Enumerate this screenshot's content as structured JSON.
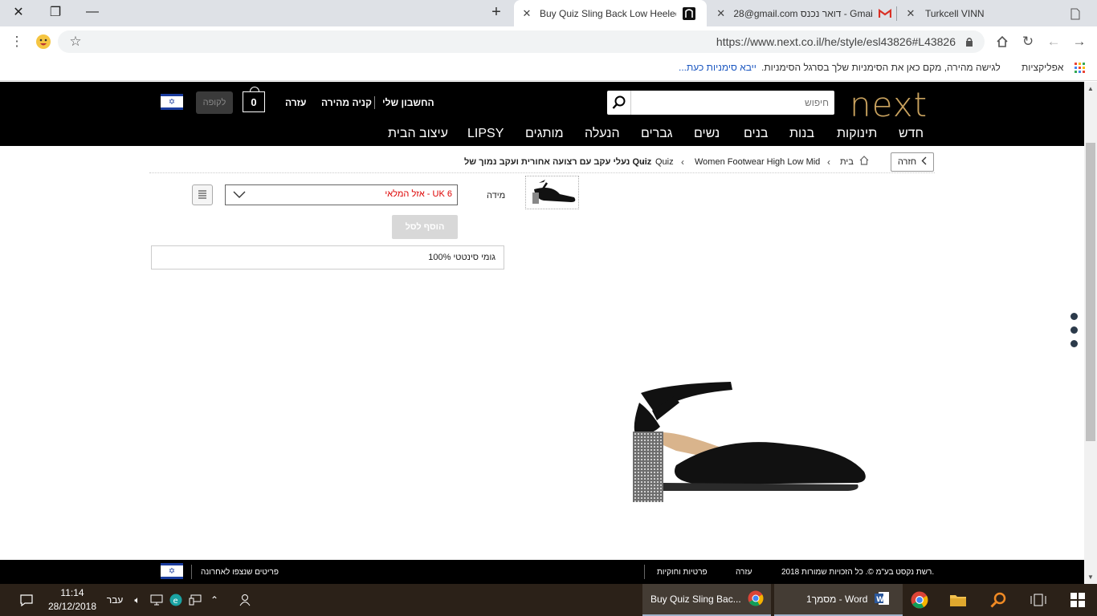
{
  "browser": {
    "tabs": [
      {
        "title": "Turkcell VINN",
        "active": false
      },
      {
        "title": "דואר נכנס - Gmail",
        "partial_email": "28@gmail.com",
        "active": false
      },
      {
        "title": "Buy Quiz Sling Back Low Heeled",
        "active": true
      }
    ],
    "new_tab_symbol": "+",
    "url": "https://www.next.co.il/he/style/esl43826#L43826",
    "bookmarks": {
      "apps_label": "אפליקציות",
      "hint_text": "לגישה מהירה, מקם כאן את הסימניות שלך בסרגל הסימניות.",
      "import_link": "ייבא סימניות כעת..."
    }
  },
  "site": {
    "search_placeholder": "חיפוש",
    "header_links": {
      "my_account": "החשבון שלי",
      "quick_buy": "קניה מהירה",
      "help": "עזרה"
    },
    "bag_count": "0",
    "checkout_label": "לקופה",
    "nav": [
      "חדש",
      "תינוקות",
      "בנות",
      "בנים",
      "נשים",
      "גברים",
      "הנעלה",
      "מותגים",
      "LIPSY",
      "עיצוב הבית"
    ]
  },
  "breadcrumb": {
    "back": "חזרה",
    "items": [
      "בית",
      "Women Footwear High Low Mid",
      "Quiz",
      "נעלי עקב עם רצועה אחורית ועקב נמוך של Quiz"
    ]
  },
  "product": {
    "size_label": "מידה",
    "size_value": "UK 6 - אזל המלאי",
    "add_to_bag": "הוסף לסל",
    "material": "100% גומי סינטטי"
  },
  "footer": {
    "copyright": "2018 רשת נקסט בע\"מ ©. כל הזכויות שמורות.",
    "help": "עזרה",
    "privacy": "פרטיות וחוקיות",
    "recently_viewed": "פריטים שנצפו לאחרונה"
  },
  "taskbar": {
    "time": "11:14",
    "date": "28/12/2018",
    "language": "עבר",
    "chrome_window": "Buy Quiz Sling Bac...",
    "word_window": "מסמך1 - Word"
  },
  "colors": {
    "brand_gold": "#c9a25e",
    "header_black": "#000000",
    "out_of_stock_red": "#dd0000"
  }
}
